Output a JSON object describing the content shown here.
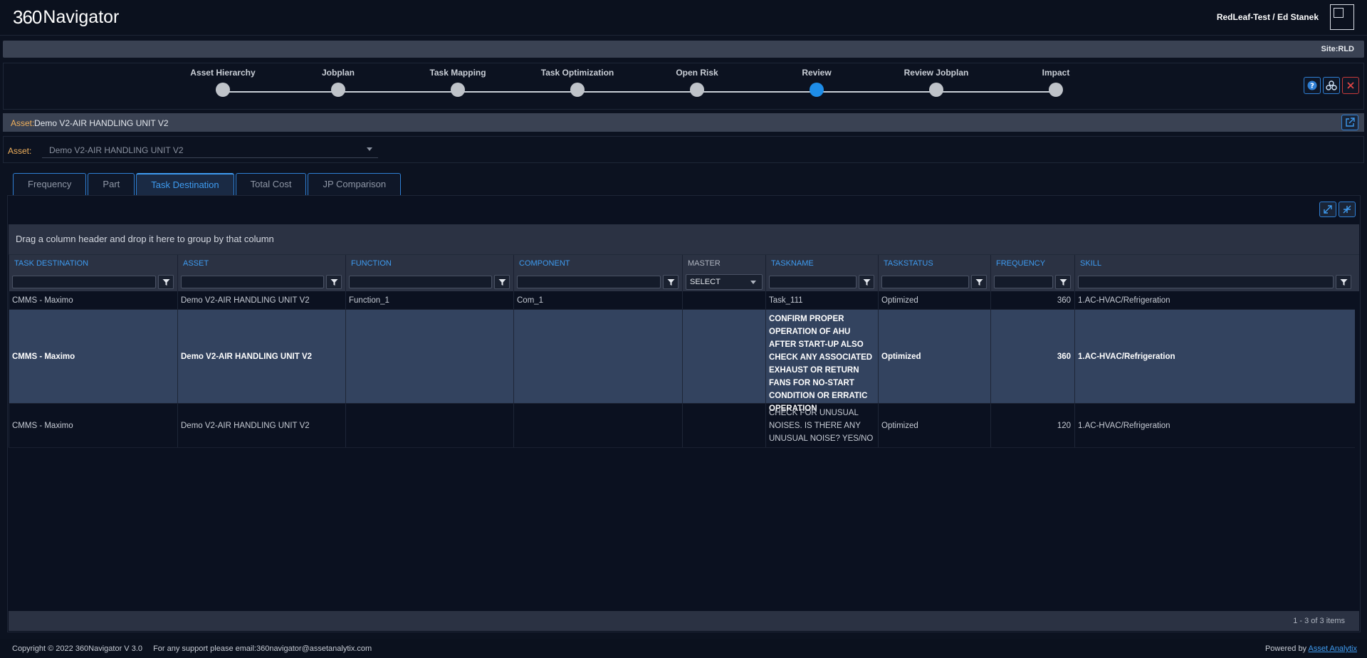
{
  "header": {
    "logo_num": "360",
    "logo_text": "Navigator",
    "user": "RedLeaf-Test / Ed Stanek",
    "site": "Site:RLD"
  },
  "stepper": {
    "steps": [
      {
        "label": "Asset Hierarchy",
        "active": false
      },
      {
        "label": "Jobplan",
        "active": false
      },
      {
        "label": "Task Mapping",
        "active": false
      },
      {
        "label": "Task Optimization",
        "active": false
      },
      {
        "label": "Open Risk",
        "active": false
      },
      {
        "label": "Review",
        "active": true
      },
      {
        "label": "Review Jobplan",
        "active": false
      },
      {
        "label": "Impact",
        "active": false
      }
    ],
    "active_color": "#1e8de8"
  },
  "asset_bar": {
    "label": "Asset:",
    "value": "Demo V2-AIR HANDLING UNIT V2"
  },
  "asset_selector": {
    "label": "Asset:",
    "value": "Demo V2-AIR HANDLING UNIT V2"
  },
  "tabs": [
    {
      "label": "Frequency",
      "active": false
    },
    {
      "label": "Part",
      "active": false
    },
    {
      "label": "Task Destination",
      "active": true
    },
    {
      "label": "Total Cost",
      "active": false
    },
    {
      "label": "JP Comparison",
      "active": false
    }
  ],
  "grid": {
    "group_hint": "Drag a column header and drop it here to group by that column",
    "columns": [
      "TASK DESTINATION",
      "ASSET",
      "FUNCTION",
      "COMPONENT",
      "MASTER",
      "TASKNAME",
      "TASKSTATUS",
      "FREQUENCY",
      "SKILL"
    ],
    "master_filter": "SELECT",
    "rows": [
      [
        "CMMS - Maximo",
        "Demo V2-AIR HANDLING UNIT V2",
        "Function_1",
        "Com_1",
        "",
        "Task_111",
        "Optimized",
        "360",
        "1.AC-HVAC/Refrigeration"
      ],
      [
        "CMMS - Maximo",
        "Demo V2-AIR HANDLING UNIT V2",
        "",
        "",
        "",
        "CONFIRM PROPER OPERATION OF AHU AFTER START-UP ALSO CHECK ANY ASSOCIATED EXHAUST OR RETURN FANS FOR NO-START CONDITION OR ERRATIC OPERATION",
        "Optimized",
        "360",
        "1.AC-HVAC/Refrigeration"
      ],
      [
        "CMMS - Maximo",
        "Demo V2-AIR HANDLING UNIT V2",
        "",
        "",
        "",
        "CHECK FOR UNUSUAL NOISES. IS THERE ANY UNUSUAL NOISE? YES/NO",
        "Optimized",
        "120",
        "1.AC-HVAC/Refrigeration"
      ]
    ],
    "selected_row": 1,
    "pager": "1 - 3 of 3 items"
  },
  "footer": {
    "copyright": "Copyright © 2022 360Navigator V 3.0",
    "support": "For any support please email:360navigator@assetanalytix.com",
    "powered_by": "Powered by",
    "powered_link": "Asset Analytix"
  },
  "colors": {
    "accent": "#3e9bf0",
    "asset_label": "#f0b05c",
    "close": "#c83a3a"
  }
}
